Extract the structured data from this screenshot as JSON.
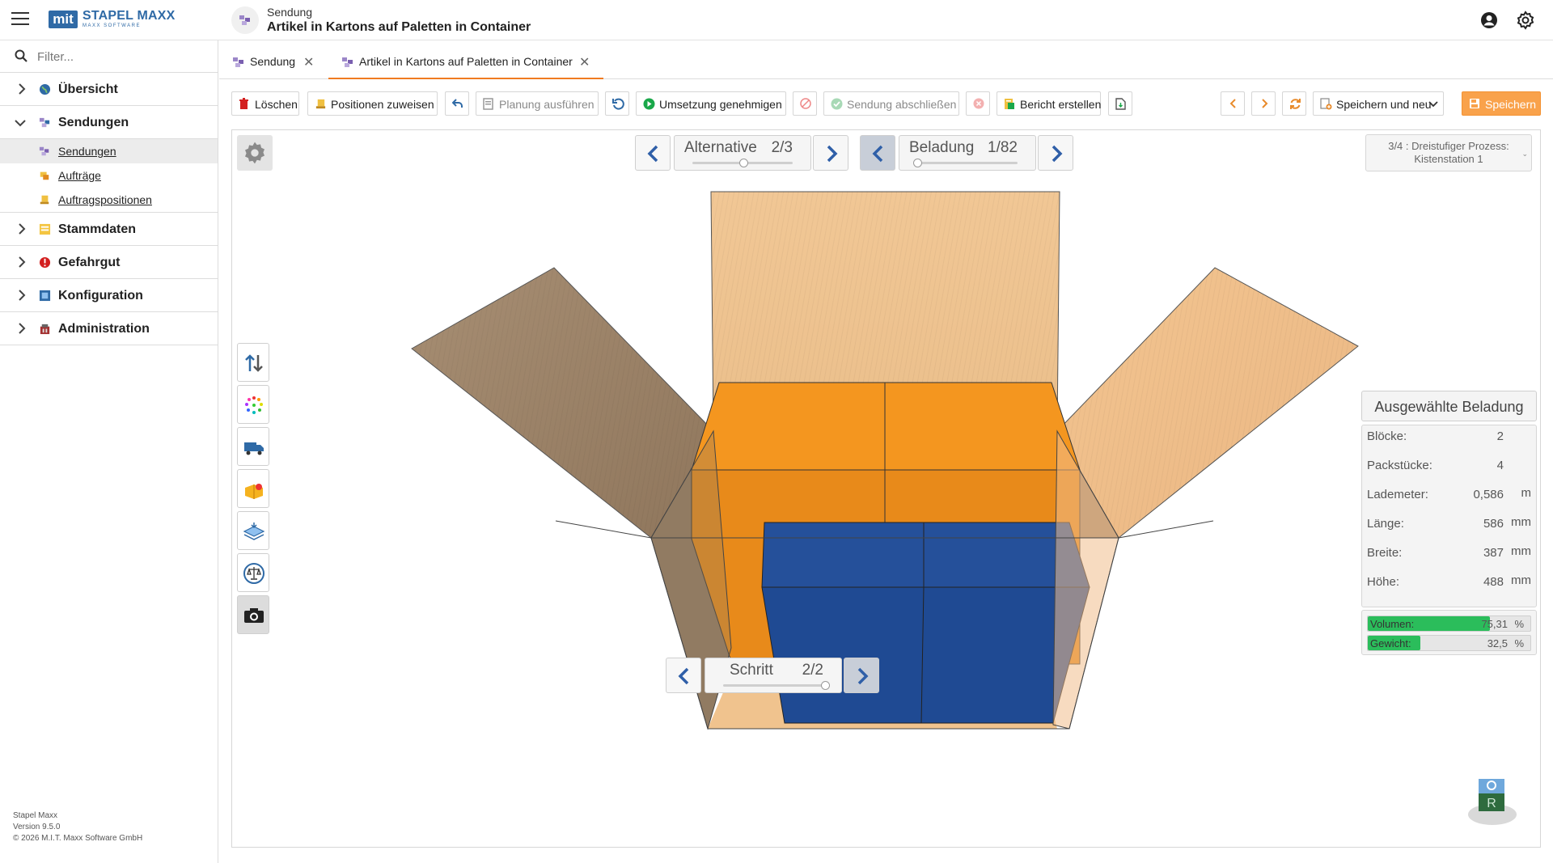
{
  "app": {
    "brand": "STAPEL MAXX",
    "brand_sub": "MAXX SOFTWARE",
    "logo_mark": "mit",
    "doc_type": "Sendung",
    "doc_title": "Artikel in Kartons auf Paletten in Container"
  },
  "sidebar": {
    "filter_placeholder": "Filter...",
    "items": [
      {
        "label": "Übersicht",
        "icon": "globe-icon",
        "color": "#2f6aa6"
      },
      {
        "label": "Sendungen",
        "icon": "shipment-icon",
        "color": "#7a5fb0",
        "expanded": true,
        "children": [
          {
            "label": "Sendungen",
            "icon": "shipment-icon",
            "active": true
          },
          {
            "label": "Aufträge",
            "icon": "orders-icon"
          },
          {
            "label": "Auftragspositionen",
            "icon": "order-positions-icon"
          }
        ]
      },
      {
        "label": "Stammdaten",
        "icon": "master-data-icon",
        "color": "#e0a020"
      },
      {
        "label": "Gefahrgut",
        "icon": "hazard-icon",
        "color": "#d32020"
      },
      {
        "label": "Konfiguration",
        "icon": "config-icon",
        "color": "#2f6aa6"
      },
      {
        "label": "Administration",
        "icon": "admin-icon",
        "color": "#a33030"
      }
    ],
    "footer": {
      "product": "Stapel Maxx",
      "version": "Version 9.5.0",
      "copyright": "© 2026 M.I.T. Maxx Software GmbH"
    }
  },
  "tabs": [
    {
      "label": "Sendung",
      "active": false
    },
    {
      "label": "Artikel in Kartons auf Paletten in Container",
      "active": true
    }
  ],
  "toolbar": {
    "delete": "Löschen",
    "assign_positions": "Positionen zuweisen",
    "run_planning": "Planung ausführen",
    "approve_implementation": "Umsetzung genehmigen",
    "complete_shipment": "Sendung abschließen",
    "create_report": "Bericht erstellen",
    "save_and_new": "Speichern und neu",
    "save": "Speichern",
    "save_color": "#f9a24b"
  },
  "viewer": {
    "alternative": {
      "label": "Alternative",
      "value": "2/3",
      "position": 0.5
    },
    "loading": {
      "label": "Beladung",
      "value": "1/82",
      "position": 0.0
    },
    "step": {
      "label": "Schritt",
      "value": "2/2",
      "position": 1.0
    },
    "process_line1": "3/4 : Dreistufiger Prozess:",
    "process_line2": "Kistenstation 1",
    "cube_label": "R"
  },
  "info_panel": {
    "title": "Ausgewählte Beladung",
    "rows": [
      {
        "label": "Blöcke:",
        "value": "2",
        "unit": ""
      },
      {
        "label": "Packstücke:",
        "value": "4",
        "unit": ""
      },
      {
        "label": "Lademeter:",
        "value": "0,586",
        "unit": "m"
      },
      {
        "label": "Länge:",
        "value": "586",
        "unit": "mm"
      },
      {
        "label": "Breite:",
        "value": "387",
        "unit": "mm"
      },
      {
        "label": "Höhe:",
        "value": "488",
        "unit": "mm"
      }
    ],
    "volume": {
      "label": "Volumen:",
      "value": "75,31",
      "unit": "%",
      "percent": 75.31
    },
    "weight": {
      "label": "Gewicht:",
      "value": "32,5",
      "unit": "%",
      "percent": 32.5
    }
  },
  "colors": {
    "accent_orange": "#f07b20",
    "box_orange": "#f2921f",
    "box_blue": "#1f4a93",
    "carton": "#e9b98a",
    "progress_green": "#2bbd5b"
  }
}
